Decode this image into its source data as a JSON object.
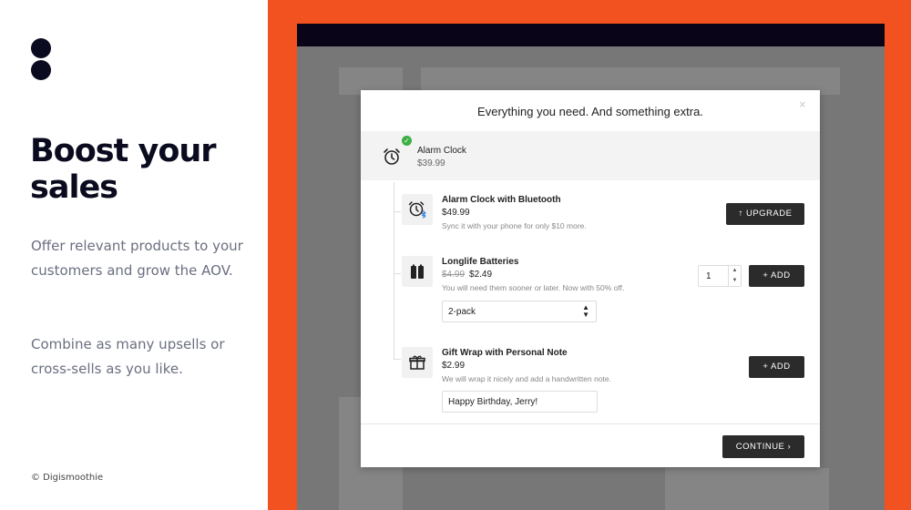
{
  "left": {
    "headline": "Boost your sales",
    "paragraph1": "Offer relevant products to your customers and grow the AOV.",
    "paragraph2": "Combine as many upsells or cross-sells as you like.",
    "copyright": "© Digismoothie"
  },
  "colors": {
    "brand_orange": "#f2521f",
    "dark": "#0b0b1f",
    "button": "#2b2b2b",
    "check": "#3cb043"
  },
  "modal": {
    "title": "Everything you need. And something extra.",
    "close_icon": "×",
    "main_product": {
      "icon": "alarm-clock-icon",
      "name": "Alarm Clock",
      "price": "$39.99"
    },
    "items": [
      {
        "icon": "alarm-clock-bluetooth-icon",
        "name": "Alarm Clock with Bluetooth",
        "price": "$49.99",
        "description": "Sync it with your phone for only $10 more.",
        "button": "↑ UPGRADE"
      },
      {
        "icon": "batteries-icon",
        "name": "Longlife Batteries",
        "old_price": "$4.99",
        "price": "$2.49",
        "description": "You will need them sooner or later. Now with 50% off.",
        "quantity": "1",
        "variant": "2-pack",
        "button": "+ ADD"
      },
      {
        "icon": "gift-icon",
        "name": "Gift Wrap with Personal Note",
        "price": "$2.99",
        "description": "We will wrap it nicely and add a handwritten note.",
        "note_value": "Happy Birthday, Jerry!",
        "button": "+ ADD"
      }
    ],
    "continue_button": "CONTINUE  ›"
  }
}
